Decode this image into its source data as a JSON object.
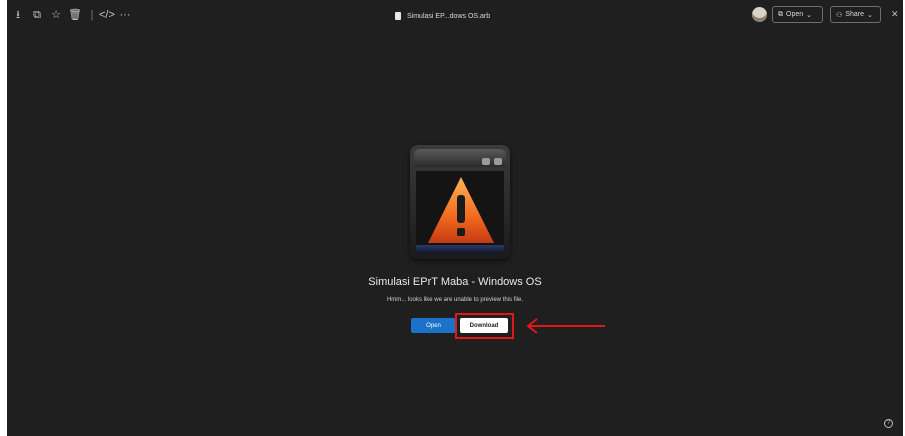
{
  "topbar": {
    "icons": [
      "download-icon",
      "copy-icon",
      "star-icon",
      "trash-icon",
      "divider",
      "code-icon",
      "more-icon"
    ],
    "title": "Simulasi EP...dows OS.arb",
    "open_label": "Open",
    "share_label": "Share"
  },
  "preview": {
    "file_name": "Simulasi EPrT Maba - Windows OS",
    "message": "Hmm... looks like we are unable to preview this file.",
    "open_button": "Open",
    "download_button": "Download"
  },
  "colors": {
    "background": "#1f1f1f",
    "open_button": "#1a73c8",
    "highlight": "#e01818"
  }
}
